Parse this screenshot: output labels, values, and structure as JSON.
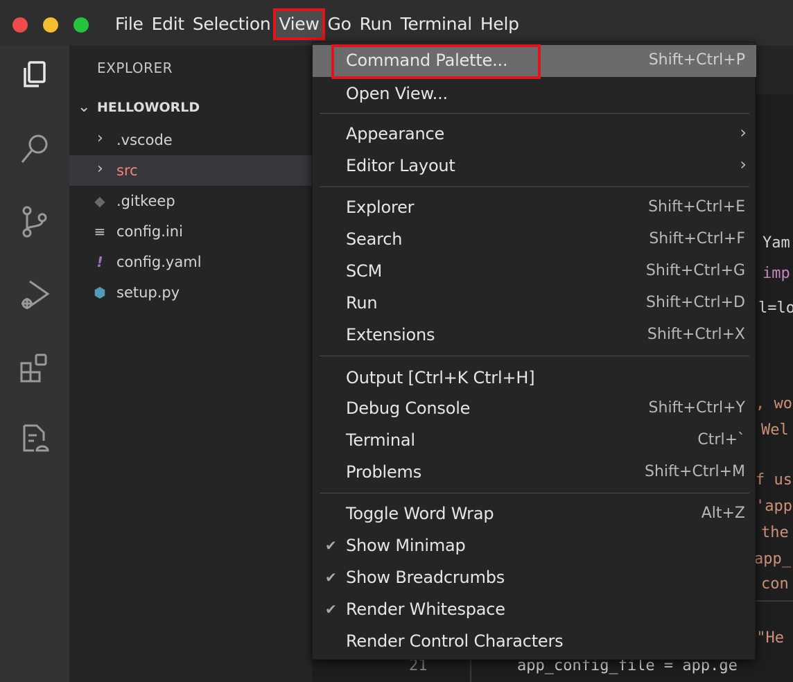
{
  "menubar": {
    "items": [
      "File",
      "Edit",
      "Selection",
      "View",
      "Go",
      "Run",
      "Terminal",
      "Help"
    ],
    "active": "View"
  },
  "activitybar": {
    "icons": [
      "files-icon",
      "search-icon",
      "source-control-icon",
      "run-debug-icon",
      "extensions-icon",
      "remote-explorer-icon"
    ]
  },
  "sidebar": {
    "title": "EXPLORER",
    "folder": "HELLOWORLD",
    "items": [
      {
        "label": ".vscode",
        "type": "folder"
      },
      {
        "label": "src",
        "type": "folder",
        "selected": true
      },
      {
        "label": ".gitkeep",
        "type": "file"
      },
      {
        "label": "config.ini",
        "type": "file"
      },
      {
        "label": "config.yaml",
        "type": "file"
      },
      {
        "label": "setup.py",
        "type": "file"
      }
    ]
  },
  "editor": {
    "fragments": [
      "Yam",
      "imp",
      "l=lo",
      ", wo",
      "Wel",
      "f us",
      "'app",
      "the",
      "app_",
      "con",
      "=\"He",
      "app_config_file = app.ge"
    ],
    "line_number": "21"
  },
  "view_menu": {
    "items": [
      {
        "label": "Command Palette...",
        "shortcut": "Shift+Ctrl+P"
      },
      {
        "label": "Open View...",
        "shortcut": ""
      },
      {
        "label": "Appearance",
        "shortcut": ""
      },
      {
        "label": "Editor Layout",
        "shortcut": ""
      },
      {
        "label": "Explorer",
        "shortcut": "Shift+Ctrl+E"
      },
      {
        "label": "Search",
        "shortcut": "Shift+Ctrl+F"
      },
      {
        "label": "SCM",
        "shortcut": "Shift+Ctrl+G"
      },
      {
        "label": "Run",
        "shortcut": "Shift+Ctrl+D"
      },
      {
        "label": "Extensions",
        "shortcut": "Shift+Ctrl+X"
      },
      {
        "label": "Output [Ctrl+K Ctrl+H]",
        "shortcut": ""
      },
      {
        "label": "Debug Console",
        "shortcut": "Shift+Ctrl+Y"
      },
      {
        "label": "Terminal",
        "shortcut": "Ctrl+`"
      },
      {
        "label": "Problems",
        "shortcut": "Shift+Ctrl+M"
      },
      {
        "label": "Toggle Word Wrap",
        "shortcut": "Alt+Z"
      },
      {
        "label": "Show Minimap",
        "shortcut": ""
      },
      {
        "label": "Show Breadcrumbs",
        "shortcut": ""
      },
      {
        "label": "Render Whitespace",
        "shortcut": ""
      },
      {
        "label": "Render Control Characters",
        "shortcut": ""
      }
    ]
  },
  "colors": {
    "highlight_outline": "#e0151b",
    "menu_bg": "#252526",
    "menu_highlight": "#6b6b6b"
  }
}
